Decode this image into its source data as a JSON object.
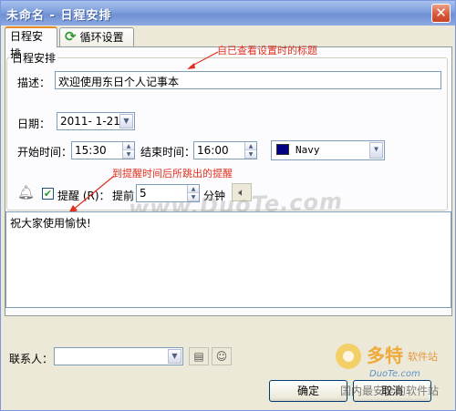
{
  "window": {
    "title": "未命名 - 日程安排",
    "close_glyph": "✕"
  },
  "tabs": [
    {
      "label": "日程安排",
      "active": true
    },
    {
      "label": "循环设置",
      "active": false,
      "icon": "refresh-icon"
    }
  ],
  "group": {
    "label": "日程安排"
  },
  "form": {
    "description_label": "描述：",
    "description_value": "欢迎使用东日个人记事本",
    "date_label": "日期：",
    "date_value": "2011- 1-21",
    "start_label": "开始时间：",
    "start_value": "15:30",
    "end_label": "结束时间：",
    "end_value": "16:00",
    "color_value": "Navy",
    "color_hex": "#000080",
    "reminder_label": "提醒 (R)：",
    "reminder_checked": true,
    "advance_label": "提前",
    "advance_value": "5",
    "minutes_label": "分钟"
  },
  "memo": {
    "text": "祝大家使用愉快!"
  },
  "contact": {
    "label": "联系人：",
    "value": ""
  },
  "buttons": {
    "ok": "确定",
    "cancel": "取消"
  },
  "annotations": {
    "title_note": "自已查看设置时的标题",
    "reminder_note": "到提醒时间后所跳出的提醒"
  },
  "watermark": {
    "text": "www.DuoTe.com"
  },
  "site_logo": {
    "name": "多特",
    "sub": "软件站",
    "url_text": "DuoTe.com",
    "tagline": "国内最安全的软件站"
  },
  "colors": {
    "accent": "#e68b2c",
    "annotation": "#e0301e",
    "titlebar": "#7e9fdc"
  }
}
